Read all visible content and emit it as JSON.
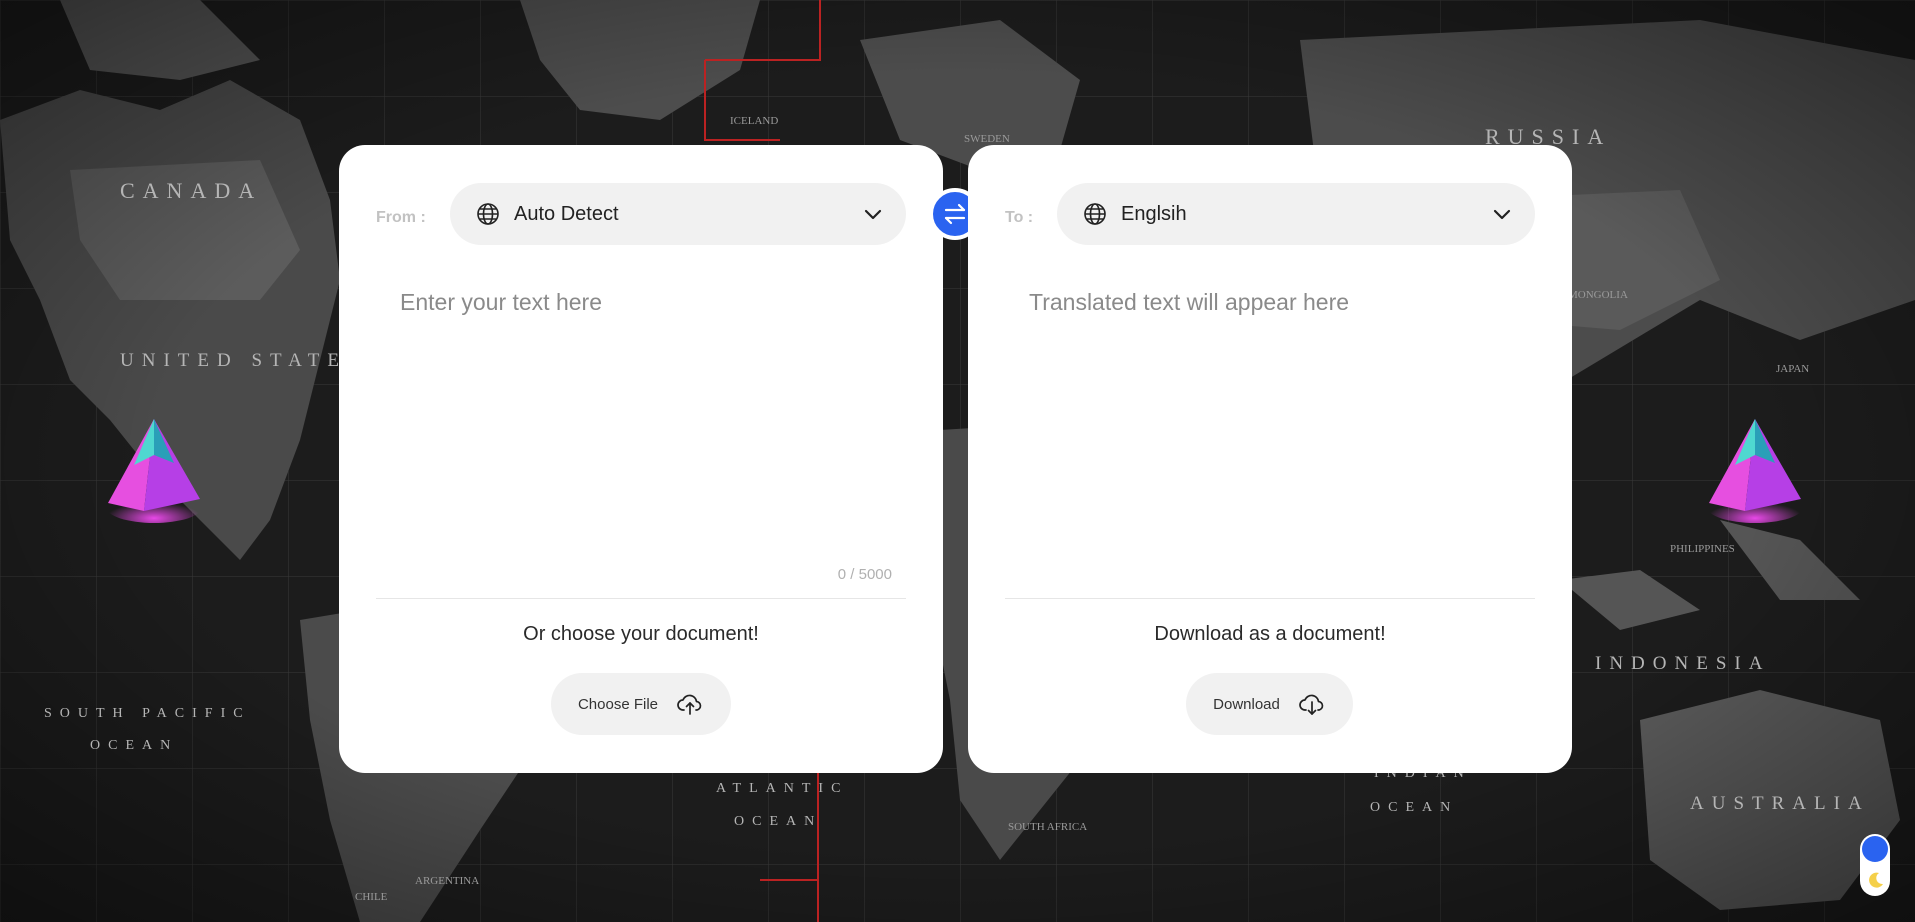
{
  "map": {
    "labels": [
      "CANADA",
      "UNITED STATES",
      "RUSSIA",
      "AUSTRALIA",
      "INDONESIA",
      "SOUTH PACIFIC",
      "OCEAN",
      "ATLANTIC",
      "OCEAN",
      "INDIAN",
      "OCEAN",
      "PHILIPPINES",
      "ARGENTINA",
      "CHILE",
      "SOUTH AFRICA",
      "JAPAN",
      "ICELAND",
      "SWEDEN",
      "MONGOLIA"
    ]
  },
  "source": {
    "label": "From :",
    "language": "Auto Detect",
    "placeholder": "Enter your text here",
    "char_count": "0 / 5000",
    "doc_caption": "Or choose your document!",
    "button_label": "Choose File"
  },
  "target": {
    "label": "To :",
    "language": "Englsih",
    "placeholder": "Translated text will appear here",
    "doc_caption": "Download as a document!",
    "button_label": "Download"
  },
  "colors": {
    "accent": "#2a63f0",
    "panel": "#ffffff",
    "control_bg": "#f1f1f1"
  }
}
